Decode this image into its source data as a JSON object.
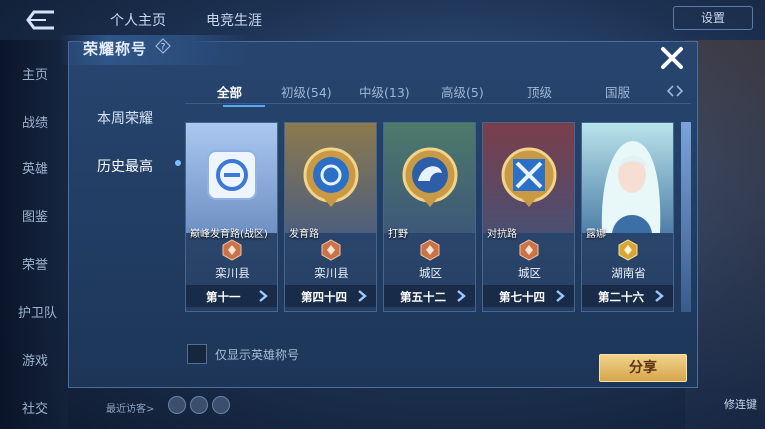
{
  "background": {
    "tabs": [
      "个人主页",
      "电竞生涯"
    ],
    "settings_label": "设置",
    "left_nav": [
      "主页",
      "战绩",
      "英雄",
      "图鉴",
      "荣誉",
      "护卫队",
      "游戏",
      "社交"
    ],
    "recent_visitors_label": "最近访客>",
    "right_label": "修连键"
  },
  "dialog": {
    "title": "荣耀称号",
    "sidebar": [
      {
        "label": "本周荣耀",
        "active": false
      },
      {
        "label": "历史最高",
        "active": true
      }
    ],
    "tabs": [
      {
        "label": "全部",
        "active": true
      },
      {
        "label": "初级(54)",
        "active": false
      },
      {
        "label": "中级(13)",
        "active": false
      },
      {
        "label": "高级(5)",
        "active": false
      },
      {
        "label": "顶级",
        "active": false
      },
      {
        "label": "国服",
        "active": false
      }
    ],
    "cards": [
      {
        "title": "巅峰发育路(战区)",
        "region": "栾川县",
        "rank": "第十一",
        "icon": "peak-lane-icon",
        "tier_color": "#c9734a"
      },
      {
        "title": "发育路",
        "region": "栾川县",
        "rank": "第四十四",
        "icon": "marksman-lane-icon",
        "tier_color": "#c9734a"
      },
      {
        "title": "打野",
        "region": "城区",
        "rank": "第五十二",
        "icon": "jungle-dragon-icon",
        "tier_color": "#c9734a"
      },
      {
        "title": "对抗路",
        "region": "城区",
        "rank": "第七十四",
        "icon": "clash-lane-icon",
        "tier_color": "#c9734a"
      },
      {
        "title": "露娜",
        "region": "湖南省",
        "rank": "第二十六",
        "icon": "hero-portrait-luna",
        "tier_color": "#d8a637"
      }
    ],
    "filter_label": "仅显示英雄称号",
    "filter_checked": false,
    "share_label": "分享"
  },
  "colors": {
    "accent_blue": "#58a8ff",
    "share_gold": "#e2b662",
    "dialog_bg": "#223e65"
  }
}
